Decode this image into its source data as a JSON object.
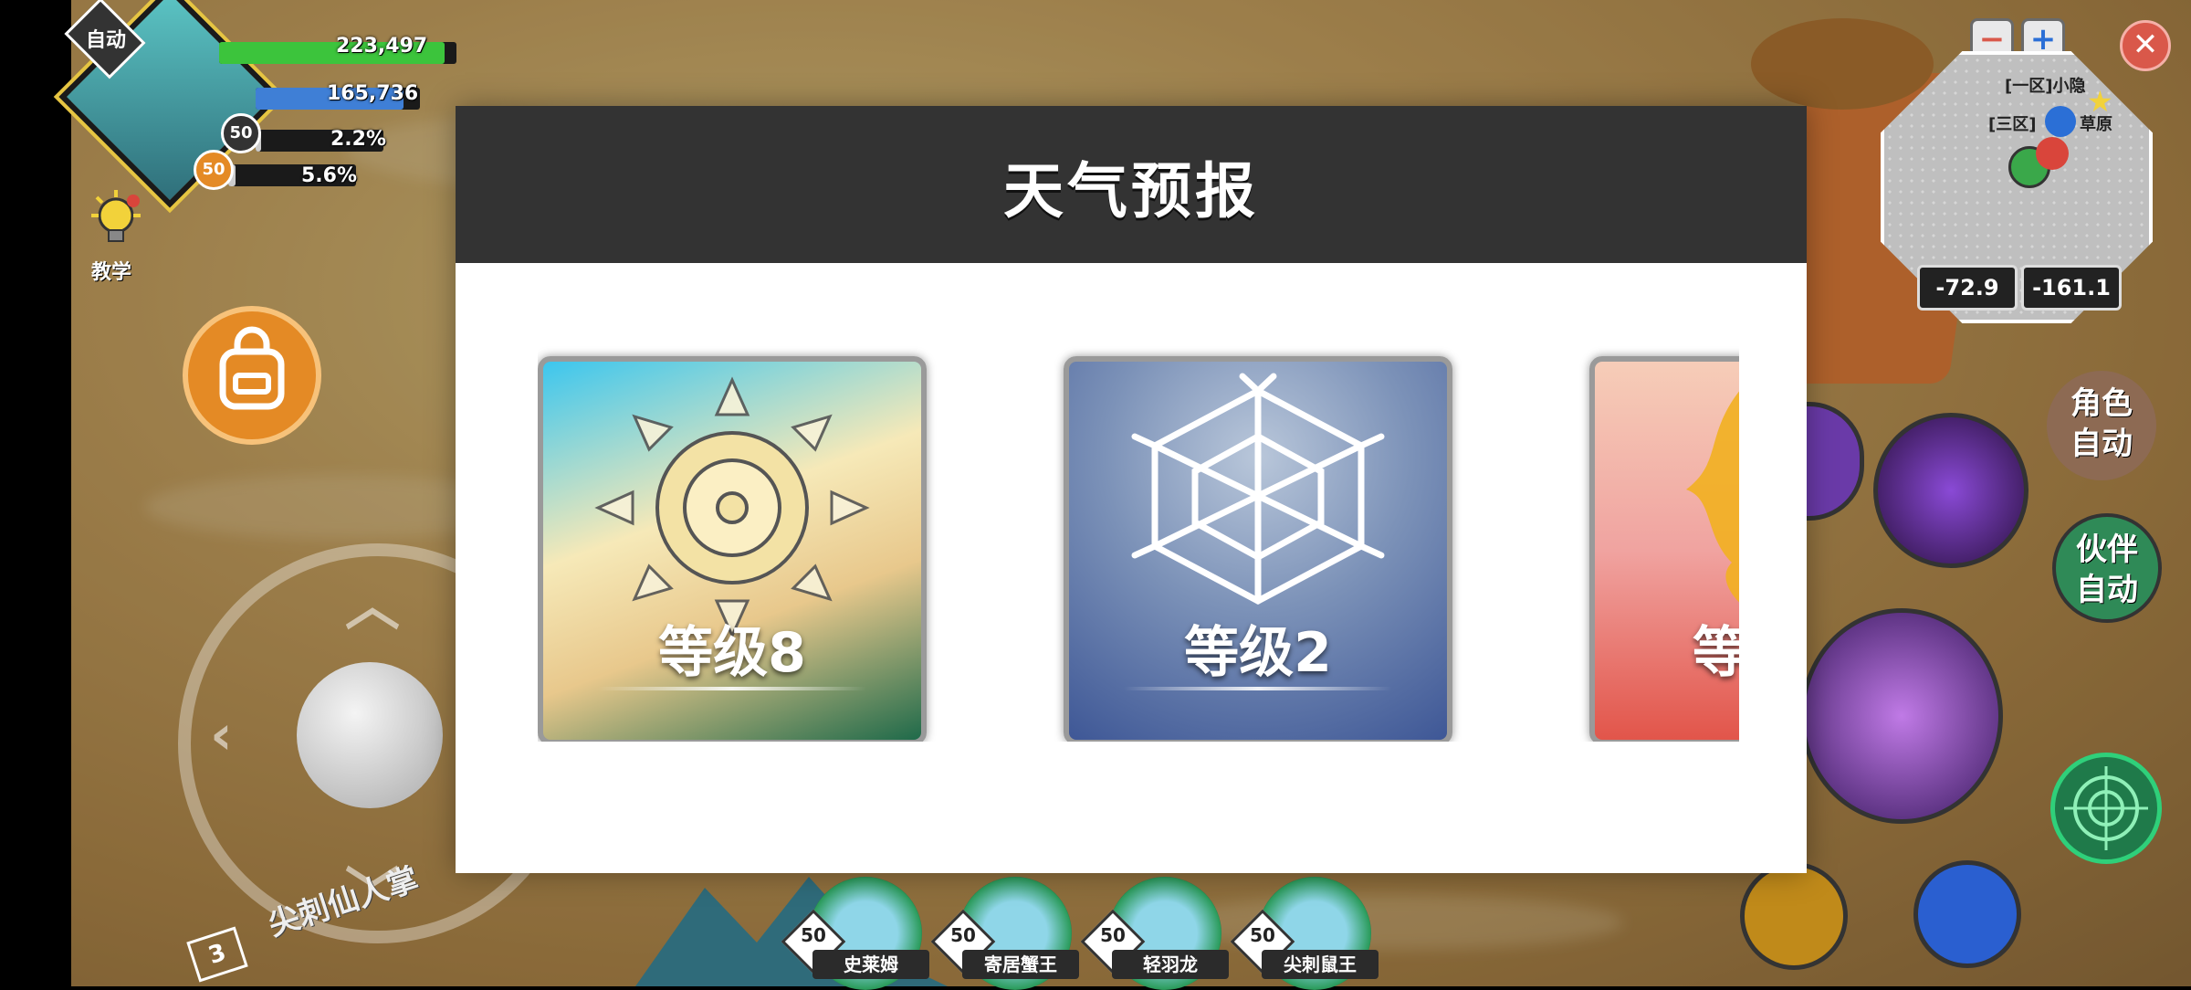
{
  "hud": {
    "auto_label": "自动",
    "hp_value": "223,497",
    "mp_value": "165,736",
    "exp1_value": "2.2%",
    "exp2_value": "5.6%",
    "player_level": "50",
    "pet_level": "50",
    "tutorial_label": "教学",
    "hp_fraction": 0.95,
    "mp_fraction": 0.9
  },
  "minimap": {
    "zone1": "[一区]小隐",
    "zone2": "[三区]",
    "zone2_suffix": "草原",
    "coord_x": "-72.9",
    "coord_y": "-161.1",
    "zoom_out": "−",
    "zoom_in": "+"
  },
  "close_label": "✕",
  "right_controls": {
    "role_auto": "角色\n自动",
    "role_auto_line1": "角色",
    "role_auto_line2": "自动",
    "partner_auto_line1": "伙伴",
    "partner_auto_line2": "自动"
  },
  "bottom_text": "尖刺仙人掌",
  "bottom_badge": "3",
  "pets": [
    {
      "name": "史莱姆",
      "level": "50"
    },
    {
      "name": "寄居蟹王",
      "level": "50"
    },
    {
      "name": "轻羽龙",
      "level": "50"
    },
    {
      "name": "尖刺鼠王",
      "level": "50"
    }
  ],
  "modal": {
    "title": "天气预报",
    "cards": [
      {
        "weather_icon": "sun-icon",
        "level_text": "等级8"
      },
      {
        "weather_icon": "snowflake-icon",
        "level_text": "等级2"
      },
      {
        "weather_icon": "fire-icon",
        "level_text": "等"
      }
    ]
  },
  "colors": {
    "modal_header": "#333333",
    "hp_bar": "#3cc43c",
    "mp_bar": "#3f7fd6"
  }
}
